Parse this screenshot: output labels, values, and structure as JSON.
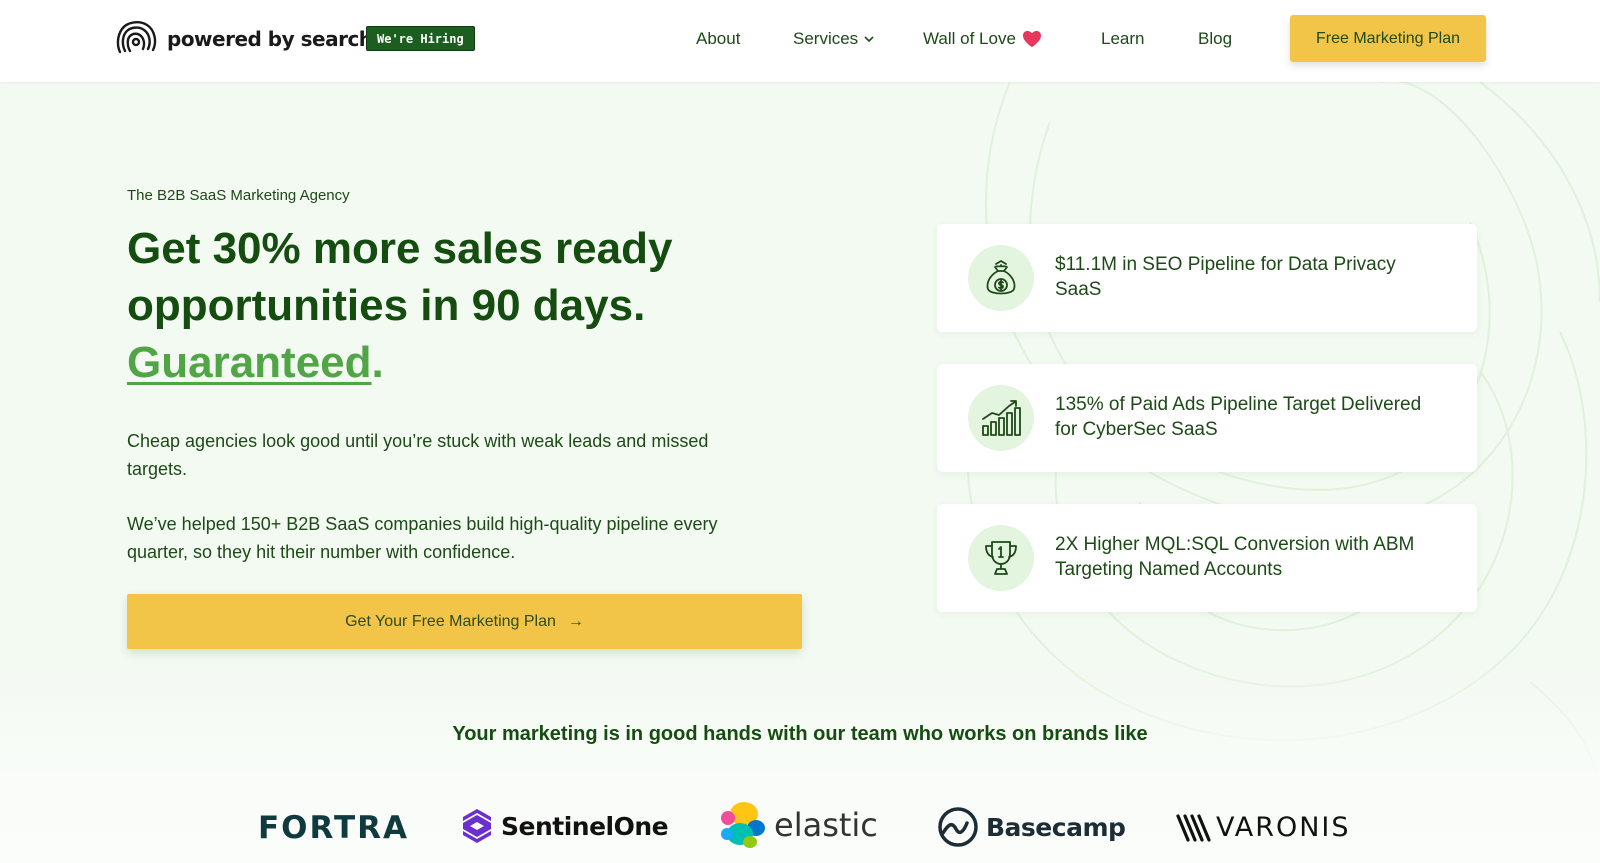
{
  "header": {
    "logo_text": "powered by search",
    "hiring_badge": "We're Hiring",
    "nav": {
      "about": "About",
      "services": "Services",
      "wall_of_love": "Wall of Love",
      "learn": "Learn",
      "blog": "Blog"
    },
    "cta": "Free Marketing Plan"
  },
  "hero": {
    "eyebrow": "The B2B SaaS Marketing Agency",
    "headline_line1": "Get 30% more sales ready",
    "headline_line2": "opportunities in 90 days.",
    "headline_accent": "Guaranteed",
    "headline_period": ".",
    "paragraph1": "Cheap agencies look good until you’re stuck with weak leads and missed targets.",
    "paragraph2": "We’ve helped 150+ B2B SaaS companies build high-quality pipeline every quarter, so they hit their number with confidence.",
    "cta": "Get Your Free Marketing Plan",
    "cta_arrow": "→"
  },
  "stats": [
    {
      "icon": "money-bag-icon",
      "text": "$11.1M in SEO Pipeline for Data Privacy SaaS"
    },
    {
      "icon": "bar-chart-growth-icon",
      "text": "135% of Paid Ads Pipeline Target Delivered for CyberSec SaaS"
    },
    {
      "icon": "trophy-icon",
      "text": "2X Higher MQL:SQL Conversion with ABM Targeting Named Accounts"
    }
  ],
  "brands": {
    "title": "Your marketing is in good hands with our team who works on brands like",
    "logos": [
      "FORTRA",
      "SentinelOne",
      "elastic",
      "Basecamp",
      "VARONIS"
    ]
  },
  "colors": {
    "brand_green": "#154d10",
    "accent_green": "#52a547",
    "cta_yellow": "#f2c548",
    "hiring_badge_bg": "#1b5e1f",
    "page_bg": "#f2faf1"
  }
}
